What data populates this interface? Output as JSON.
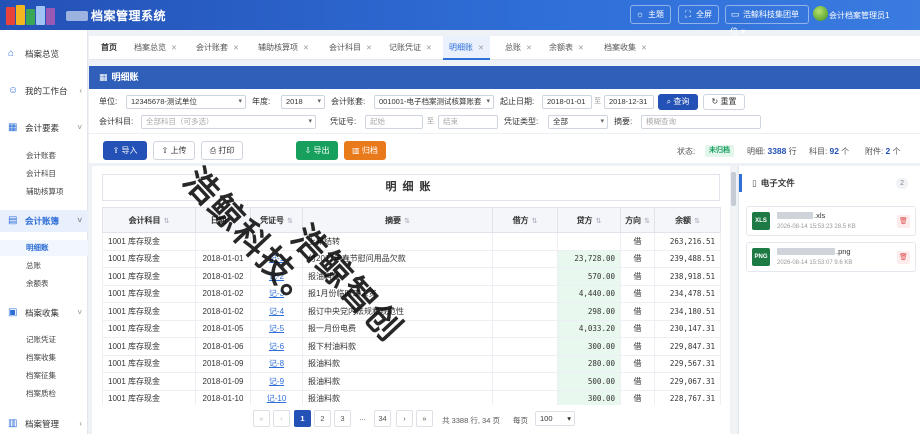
{
  "app": {
    "title": "档案管理系统",
    "header_buttons": [
      {
        "label": "主题",
        "icon": "theme-icon"
      },
      {
        "label": "全屏",
        "icon": "fullscreen-icon"
      },
      {
        "label": "浩鲸科技集团单位",
        "icon": "monitor-icon"
      }
    ],
    "user": "会计档案管理员1",
    "logo_colors": [
      "#e8443a",
      "#f3b61f",
      "#3aa757",
      "#2f6fd8",
      "#9b59b6"
    ]
  },
  "sidebar": {
    "groups": [
      {
        "label": "档案总览",
        "icon": "home-icon"
      },
      {
        "label": "我的工作台",
        "icon": "user-icon"
      },
      {
        "label": "会计要素",
        "icon": "grid-icon",
        "children": [
          "会计账套",
          "会计科目",
          "辅助核算项"
        ]
      },
      {
        "label": "会计账簿",
        "icon": "book-icon",
        "children": [
          "明细账",
          "总账",
          "余额表"
        ]
      },
      {
        "label": "档案收集",
        "icon": "collect-icon",
        "children": [
          "记账凭证",
          "档案收集",
          "档案征集",
          "档案质检"
        ]
      },
      {
        "label": "档案管理",
        "icon": "archive-icon"
      }
    ]
  },
  "tabs": [
    "首页",
    "档案总览",
    "会计账套",
    "辅助核算项",
    "会计科目",
    "记账凭证",
    "明细账",
    "总账",
    "余额表",
    "档案收集"
  ],
  "panel": {
    "title": "明细账"
  },
  "filters": {
    "unit_label": "单位:",
    "unit_value": "12345678-测试单位",
    "year_label": "年度:",
    "year_value": "2018",
    "ledger_label": "会计账套:",
    "ledger_value": "001001-电子档案测试核算账套",
    "date_label": "起止日期:",
    "date_from": "2018-01-01",
    "date_to_sep": "至",
    "date_to": "2018-12-31",
    "query_btn": "查询",
    "reset_btn": "重置",
    "subject_label": "会计科目:",
    "subject_placeholder": "全部科目（可多选）",
    "voucher_no_label": "凭证号:",
    "voucher_from_ph": "起始",
    "voucher_sep": "至",
    "voucher_to_ph": "结束",
    "voucher_type_label": "凭证类型:",
    "voucher_type_value": "全部",
    "summary_label": "摘要:",
    "summary_ph": "模糊查询"
  },
  "toolbar": {
    "import": "导入",
    "upload": "上传",
    "print": "打印",
    "export": "导出",
    "archive": "归档",
    "status_label": "状态:",
    "status_value": "未归档",
    "detail_label": "明细:",
    "detail_count": "3388",
    "detail_unit": "行",
    "subject_label": "科目:",
    "subject_count": "92",
    "subject_unit": "个",
    "attach_label": "附件:",
    "attach_count": "2",
    "attach_unit": "个"
  },
  "ledger": {
    "title": "明细账",
    "columns": [
      "会计科目",
      "日期",
      "凭证号",
      "摘要",
      "借方",
      "贷方",
      "方向",
      "余额"
    ],
    "rows": [
      {
        "subject": "1001 库存现金",
        "date": "",
        "voucher": "",
        "summary": "上年结转",
        "debit": "",
        "credit": "",
        "dir": "借",
        "balance": "263,216.51"
      },
      {
        "subject": "1001 库存现金",
        "date": "2018-01-01",
        "voucher": "记-1",
        "summary": "付2017年春节慰问用品欠款",
        "debit": "",
        "credit": "23,728.00",
        "dir": "借",
        "balance": "239,488.51"
      },
      {
        "subject": "1001 库存现金",
        "date": "2018-01-02",
        "voucher": "记-2",
        "summary": "报油料款",
        "debit": "",
        "credit": "570.00",
        "dir": "借",
        "balance": "238,918.51"
      },
      {
        "subject": "1001 库存现金",
        "date": "2018-01-02",
        "voucher": "记-3",
        "summary": "报1月份临时工工资",
        "debit": "",
        "credit": "4,440.00",
        "dir": "借",
        "balance": "234,478.51"
      },
      {
        "subject": "1001 库存现金",
        "date": "2018-01-02",
        "voucher": "记-4",
        "summary": "报订中央党内法规和规范性",
        "debit": "",
        "credit": "298.00",
        "dir": "借",
        "balance": "234,180.51"
      },
      {
        "subject": "1001 库存现金",
        "date": "2018-01-05",
        "voucher": "记-5",
        "summary": "报一月份电费",
        "debit": "",
        "credit": "4,033.20",
        "dir": "借",
        "balance": "230,147.31"
      },
      {
        "subject": "1001 库存现金",
        "date": "2018-01-06",
        "voucher": "记-6",
        "summary": "报下村油料款",
        "debit": "",
        "credit": "300.00",
        "dir": "借",
        "balance": "229,847.31"
      },
      {
        "subject": "1001 库存现金",
        "date": "2018-01-09",
        "voucher": "记-8",
        "summary": "报油料款",
        "debit": "",
        "credit": "280.00",
        "dir": "借",
        "balance": "229,567.31"
      },
      {
        "subject": "1001 库存现金",
        "date": "2018-01-09",
        "voucher": "记-9",
        "summary": "报油料款",
        "debit": "",
        "credit": "500.00",
        "dir": "借",
        "balance": "229,067.31"
      },
      {
        "subject": "1001 库存现金",
        "date": "2018-01-10",
        "voucher": "记-10",
        "summary": "报油料款",
        "debit": "",
        "credit": "300.00",
        "dir": "借",
        "balance": "228,767.31"
      }
    ]
  },
  "pagination": {
    "pages": [
      "1",
      "2",
      "3",
      "...",
      "34"
    ],
    "first": "«",
    "prev": "‹",
    "next": "›",
    "last": "»",
    "summary": "共 3388 行, 34 页",
    "per_page_label": "每页",
    "per_page_value": "100"
  },
  "efile": {
    "title": "电子文件",
    "count": "2",
    "files": [
      {
        "type": "XLS",
        "ext": ".xls",
        "meta": "2026-08-14 15:53:23   28.5 KB",
        "color": "#1d7a45"
      },
      {
        "type": "PNG",
        "ext": ".png",
        "meta": "2026-08-14 15:53:07   9.6 KB",
        "color": "#1d7a45"
      }
    ]
  },
  "watermark": {
    "line1": "浩鲸科技。",
    "line2": "浩鲸智创"
  }
}
